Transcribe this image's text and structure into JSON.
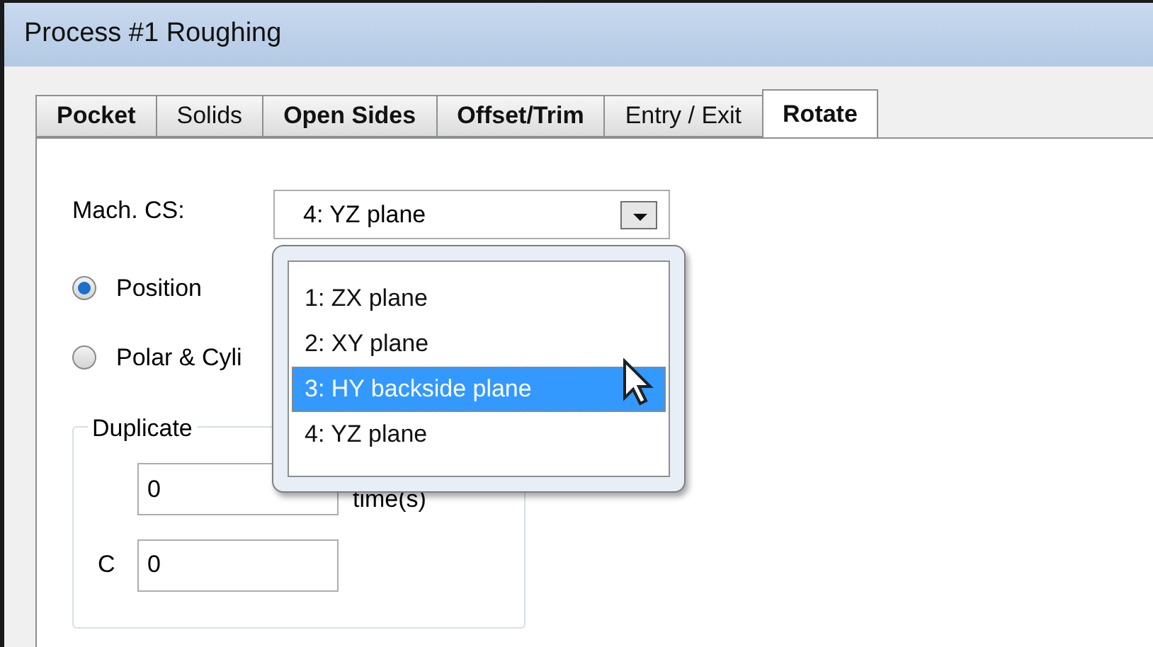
{
  "window": {
    "title": "Process #1 Roughing"
  },
  "tabs": [
    {
      "label": "Pocket",
      "bold": true,
      "selected": false
    },
    {
      "label": "Solids",
      "bold": false,
      "selected": false
    },
    {
      "label": "Open Sides",
      "bold": true,
      "selected": false
    },
    {
      "label": "Offset/Trim",
      "bold": true,
      "selected": false
    },
    {
      "label": "Entry / Exit",
      "bold": false,
      "selected": false
    },
    {
      "label": "Rotate",
      "bold": true,
      "selected": true
    }
  ],
  "mach_cs": {
    "label": "Mach. CS:",
    "value": "4: YZ plane",
    "options": [
      {
        "label": "1: ZX plane",
        "highlighted": false
      },
      {
        "label": "2: XY plane",
        "highlighted": false
      },
      {
        "label": "3: HY backside plane",
        "highlighted": true
      },
      {
        "label": "4: YZ plane",
        "highlighted": false
      }
    ]
  },
  "radios": [
    {
      "label": "Position",
      "selected": true
    },
    {
      "label": "Polar & Cyli",
      "selected": false
    }
  ],
  "duplicate": {
    "title": "Duplicate",
    "times_value": "0",
    "times_unit": "time(s)",
    "c_label": "C",
    "c_value": "0"
  }
}
